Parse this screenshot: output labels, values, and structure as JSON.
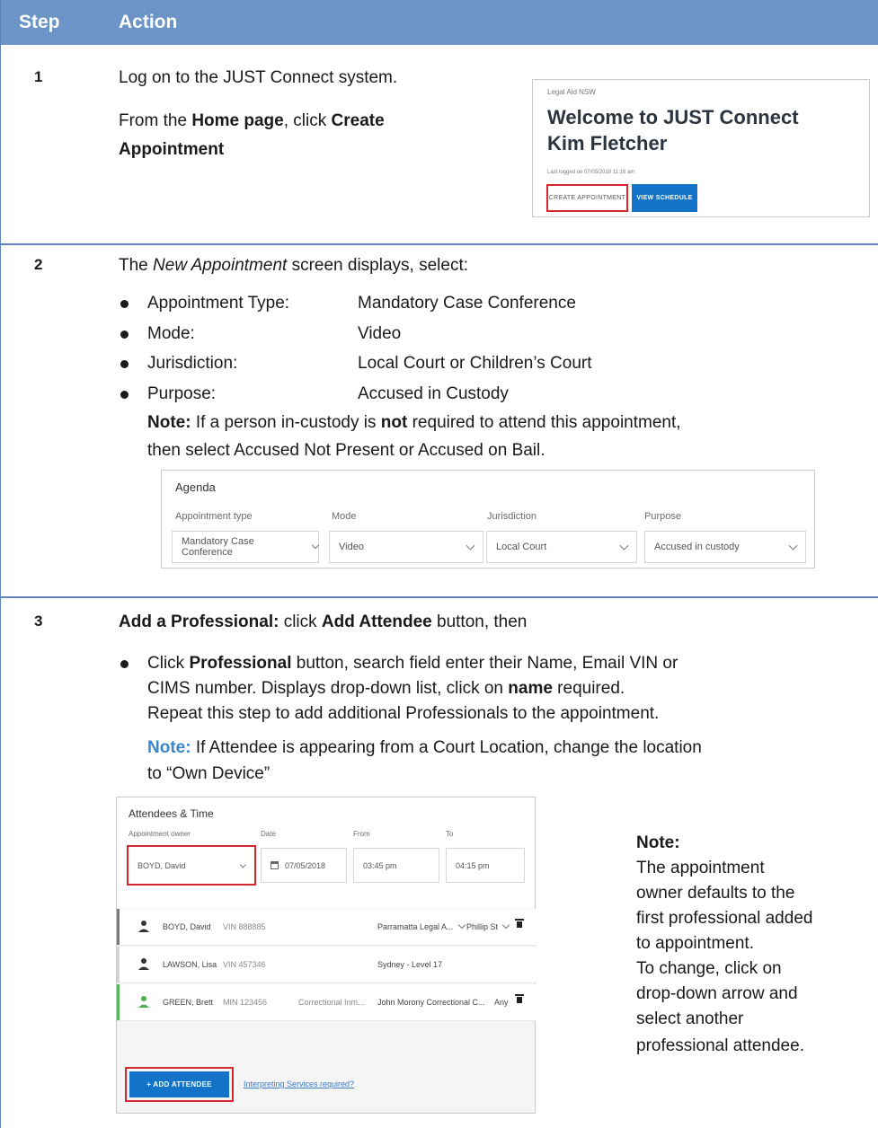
{
  "header": {
    "step": "Step",
    "action": "Action"
  },
  "step1": {
    "number": "1",
    "line1": "Log on to the JUST Connect system.",
    "line2_a": "From the ",
    "line2_b": "Home page",
    "line2_c": ", click ",
    "line2_d": "Create",
    "line3": "Appointment",
    "shot": {
      "org": "Legal Aid NSW",
      "title1": "Welcome to JUST Connect",
      "title2": "Kim Fletcher",
      "last_logged": "Last logged on 07/05/2018 11:16 am",
      "create_btn": "CREATE APPOINTMENT",
      "view_btn": "VIEW SCHEDULE"
    }
  },
  "step2": {
    "number": "2",
    "intro_a": "The ",
    "intro_b": "New Appointment",
    "intro_c": " screen displays, select:",
    "items": [
      {
        "label": "Appointment Type:",
        "value": "Mandatory Case Conference"
      },
      {
        "label": "Mode:",
        "value": "Video"
      },
      {
        "label": "Jurisdiction:",
        "value": "Local Court or Children’s Court"
      },
      {
        "label": "Purpose:",
        "value": "Accused in Custody"
      }
    ],
    "note_label": "Note:",
    "note_a": " If a person in-custody is ",
    "note_b": "not",
    "note_c": " required to attend this appointment,",
    "note_line2": "then select Accused Not Present or Accused on Bail.",
    "shot": {
      "heading": "Agenda",
      "fields": [
        {
          "label": "Appointment type",
          "value": "Mandatory Case Conference"
        },
        {
          "label": "Mode",
          "value": "Video"
        },
        {
          "label": "Jurisdiction",
          "value": "Local Court"
        },
        {
          "label": "Purpose",
          "value": "Accused in custody"
        }
      ]
    }
  },
  "step3": {
    "number": "3",
    "intro_a": "Add a Professional:",
    "intro_b": " click ",
    "intro_c": "Add Attendee",
    "intro_d": " button, then",
    "b1_a": "Click ",
    "b1_b": "Professional",
    "b1_c": " button, search field enter their Name, Email VIN or",
    "b1_line2_a": "CIMS number. Displays drop-down list, click on ",
    "b1_line2_b": "name",
    "b1_line2_c": " required.",
    "b1_line3": "Repeat this step to add additional Professionals to the appointment.",
    "note_label": "Note:",
    "note_text": " If Attendee is appearing from a Court Location, change the location",
    "note_line2": "to “Own Device”",
    "side_note": {
      "title": "Note:",
      "lines": [
        "The appointment",
        "owner defaults to the",
        "first professional added",
        "to appointment.",
        "To change, click on",
        "drop-down arrow and",
        "select another",
        "professional attendee."
      ]
    },
    "shot": {
      "heading": "Attendees & Time",
      "owner_label": "Appointment owner",
      "owner_value": "BOYD, David",
      "date_label": "Date",
      "date_value": "07/05/2018",
      "from_label": "From",
      "from_value": "03:45 pm",
      "to_label": "To",
      "to_value": "04:15 pm",
      "rows": [
        {
          "name": "BOYD, David",
          "id": "VIN 888885",
          "col3": "",
          "loc": "Parramatta Legal A...",
          "sub": "Phillip St"
        },
        {
          "name": "LAWSON, Lisa",
          "id": "VIN 457346",
          "col3": "",
          "loc": "Sydney - Level 17",
          "sub": ""
        },
        {
          "name": "GREEN, Brett",
          "id": "MIN 123456",
          "col3": "Correctional Inm...",
          "loc": "John Morony Correctional C...",
          "sub": "Any"
        }
      ],
      "add_btn": "+ ADD ATTENDEE",
      "interp_link": "Interpreting Services required?"
    }
  }
}
